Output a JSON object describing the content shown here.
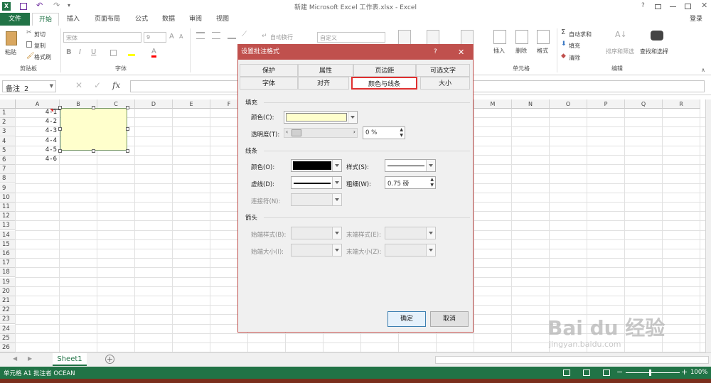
{
  "window": {
    "title": "新建 Microsoft Excel 工作表.xlsx - Excel",
    "help": "?",
    "login": "登录"
  },
  "ribbon_tabs": [
    "文件",
    "开始",
    "插入",
    "页面布局",
    "公式",
    "数据",
    "审阅",
    "视图"
  ],
  "active_tab": "开始",
  "clipboard": {
    "paste": "粘贴",
    "cut": "剪切",
    "copy": "复制",
    "format_painter": "格式刷",
    "group": "剪贴板"
  },
  "font": {
    "name": "宋体",
    "size": "9",
    "group": "字体",
    "bold": "B",
    "italic": "I",
    "underline": "U",
    "grow": "A",
    "shrink": "A"
  },
  "alignment": {
    "wrap": "自动换行"
  },
  "number": {
    "format": "自定义"
  },
  "cells": {
    "insert": "插入",
    "delete": "删除",
    "format": "格式",
    "group": "单元格"
  },
  "editing": {
    "autosum": "自动求和",
    "fill": "填充",
    "clear": "清除",
    "sort": "排序和筛选",
    "find": "查找和选择",
    "group": "编辑"
  },
  "formula_bar": {
    "name_box": "备注 2",
    "fx": "fx",
    "value": ""
  },
  "columns": [
    "A",
    "B",
    "C",
    "D",
    "E",
    "F",
    "G",
    "H",
    "I",
    "J",
    "K",
    "L",
    "M",
    "N",
    "O",
    "P",
    "Q",
    "R"
  ],
  "rows": [
    "1",
    "2",
    "3",
    "4",
    "5",
    "6",
    "7",
    "8",
    "9",
    "10",
    "11",
    "12",
    "13",
    "14",
    "15",
    "16",
    "17",
    "18",
    "19",
    "20",
    "21",
    "22",
    "23",
    "24",
    "25",
    "26"
  ],
  "cell_values": [
    "4-1",
    "4-2",
    "4-3",
    "4-4",
    "4-5",
    "4-6"
  ],
  "sheet_tabs": [
    "Sheet1"
  ],
  "status": {
    "text": "单元格 A1 批注者 OCEAN",
    "zoom": "100%"
  },
  "dialog": {
    "title": "设置批注格式",
    "help": "?",
    "tabs_row1": [
      "保护",
      "属性",
      "页边距",
      "可选文字"
    ],
    "tabs_row2": [
      "字体",
      "对齐",
      "颜色与线条",
      "大小"
    ],
    "active_tab": "颜色与线条",
    "fill": {
      "header": "填充",
      "color_label": "颜色(C):",
      "transparency_label": "透明度(T):",
      "transparency_value": "0 %",
      "color_value": "#ffffcc"
    },
    "line": {
      "header": "线条",
      "color_label": "颜色(O):",
      "style_label": "样式(S):",
      "dash_label": "虚线(D):",
      "weight_label": "粗细(W):",
      "weight_value": "0.75 磅",
      "connector_label": "连接符(N):"
    },
    "arrows": {
      "header": "箭头",
      "begin_style": "始端样式(B):",
      "end_style": "末端样式(E):",
      "begin_size": "始端大小(I):",
      "end_size": "末端大小(Z):"
    },
    "ok": "确定",
    "cancel": "取消"
  },
  "watermark": {
    "brand": "Bai du 经验",
    "url": "jingyan.baidu.com"
  },
  "colors": {
    "excel_green": "#217346",
    "dialog_accent": "#c0504d",
    "highlight_red": "#e03030",
    "comment_fill": "#ffffcc"
  }
}
